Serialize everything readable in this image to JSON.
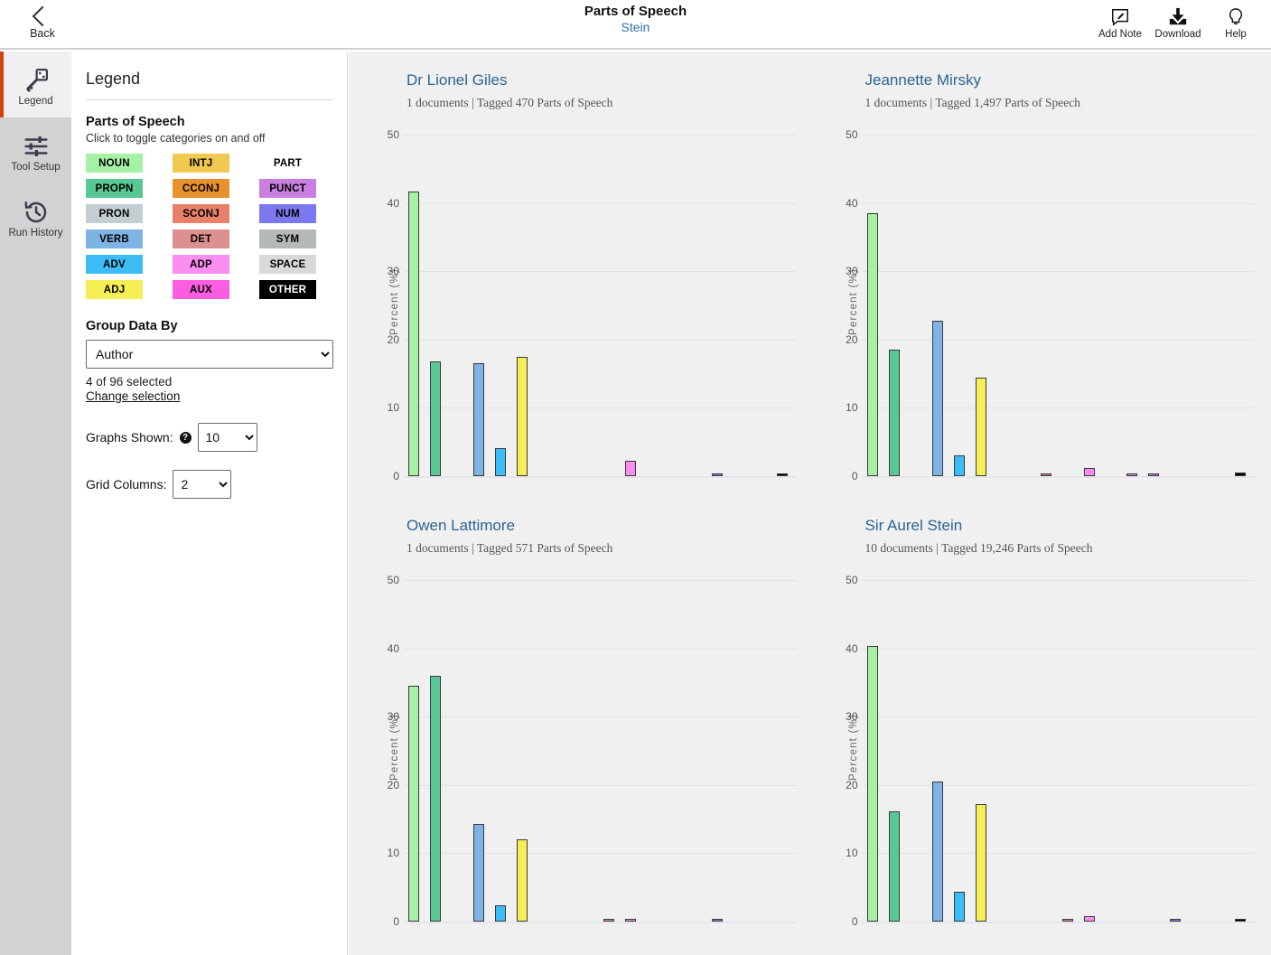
{
  "header": {
    "back_label": "Back",
    "back_icon": "chevron-left-icon",
    "title": "Parts of Speech",
    "subtitle": "Stein",
    "actions": [
      {
        "label": "Add Note",
        "icon": "add-note-icon"
      },
      {
        "label": "Download",
        "icon": "download-icon"
      },
      {
        "label": "Help",
        "icon": "lightbulb-help-icon"
      }
    ]
  },
  "rail": {
    "items": [
      {
        "label": "Legend",
        "icon": "key-icon",
        "active": true
      },
      {
        "label": "Tool Setup",
        "icon": "sliders-icon",
        "active": false
      },
      {
        "label": "Run History",
        "icon": "clock-history-icon",
        "active": false
      }
    ]
  },
  "legend": {
    "panel_title": "Legend",
    "pos_heading": "Parts of Speech",
    "pos_subtitle": "Click to toggle categories on and off",
    "categories": [
      {
        "label": "NOUN",
        "color": "#a5f2a5",
        "text_color": "#000000"
      },
      {
        "label": "INTJ",
        "color": "#f0c950",
        "text_color": "#000000"
      },
      {
        "label": "PART",
        "color": "#d munch",
        "text_color": "#000000"
      },
      {
        "label": "PROPN",
        "color": "#58c793",
        "text_color": "#000000"
      },
      {
        "label": "CCONJ",
        "color": "#e8922e",
        "text_color": "#000000"
      },
      {
        "label": "PUNCT",
        "color": "#c97fe0",
        "text_color": "#000000"
      },
      {
        "label": "PRON",
        "color": "#c3ced3",
        "text_color": "#000000"
      },
      {
        "label": "SCONJ",
        "color": "#e8806b",
        "text_color": "#000000"
      },
      {
        "label": "NUM",
        "color": "#7c78f0",
        "text_color": "#000000"
      },
      {
        "label": "VERB",
        "color": "#7fb2e5",
        "text_color": "#000000"
      },
      {
        "label": "DET",
        "color": "#dd9090",
        "text_color": "#000000"
      },
      {
        "label": "SYM",
        "color": "#b5b8b8",
        "text_color": "#000000"
      },
      {
        "label": "ADV",
        "color": "#3dbdf5",
        "text_color": "#000000"
      },
      {
        "label": "ADP",
        "color": "#fb8ef0",
        "text_color": "#000000"
      },
      {
        "label": "SPACE",
        "color": "#d9d9d9",
        "text_color": "#000000"
      },
      {
        "label": "ADJ",
        "color": "#f5ee55",
        "text_color": "#000000"
      },
      {
        "label": "AUX",
        "color": "#fb5de0",
        "text_color": "#000000"
      },
      {
        "label": "OTHER",
        "color": "#000000",
        "text_color": "#ffffff"
      }
    ],
    "group_heading": "Group Data By",
    "group_value": "Author",
    "group_options": [
      "Author"
    ],
    "selection_count": "4 of 96 selected",
    "change_selection": "Change selection",
    "graphs_shown_label": "Graphs Shown:",
    "graphs_shown_value": "10",
    "graphs_shown_options": [
      "10"
    ],
    "help_glyph": "?",
    "grid_columns_label": "Grid Columns:",
    "grid_columns_value": "2",
    "grid_columns_options": [
      "2"
    ]
  },
  "chart_data": [
    {
      "type": "bar",
      "title": "Dr Lionel Giles",
      "subtitle": "1 documents | Tagged 470 Parts of Speech",
      "documents": "1 documents",
      "tagged": "Tagged 470 Parts of Speech",
      "ylabel": "Percent (%)",
      "xlabel": "",
      "ylim": [
        0,
        50
      ],
      "yticks": [
        0,
        10,
        20,
        30,
        40,
        50
      ],
      "grid": true,
      "legend": "off",
      "categories": [
        "NOUN",
        "PROPN",
        "PRON",
        "VERB",
        "ADV",
        "ADJ",
        "INTJ",
        "CCONJ",
        "SCONJ",
        "DET",
        "ADP",
        "AUX",
        "PART",
        "PUNCT",
        "NUM",
        "SYM",
        "SPACE",
        "OTHER"
      ],
      "values": [
        41.7,
        16.8,
        0,
        16.5,
        4.1,
        17.4,
        0,
        0,
        0,
        0,
        2.3,
        0,
        0,
        0,
        0.3,
        0,
        0,
        0.3
      ],
      "colors": [
        "#a5f2a5",
        "#58c793",
        "#c3ced3",
        "#7fb2e5",
        "#3dbdf5",
        "#f5ee55",
        "#f0c950",
        "#e8922e",
        "#e8806b",
        "#dd9090",
        "#fb8ef0",
        "#fb5de0",
        "#d98ff0",
        "#c97fe0",
        "#7c78f0",
        "#b5b8b8",
        "#d9d9d9",
        "#000000"
      ]
    },
    {
      "type": "bar",
      "title": "Jeannette Mirsky",
      "subtitle": "1 documents | Tagged 1,497 Parts of Speech",
      "documents": "1 documents",
      "tagged": "Tagged 1,497 Parts of Speech",
      "ylabel": "Percent (%)",
      "xlabel": "",
      "ylim": [
        0,
        50
      ],
      "yticks": [
        0,
        10,
        20,
        30,
        40,
        50
      ],
      "grid": true,
      "legend": "off",
      "categories": [
        "NOUN",
        "PROPN",
        "PRON",
        "VERB",
        "ADV",
        "ADJ",
        "INTJ",
        "CCONJ",
        "SCONJ",
        "DET",
        "ADP",
        "AUX",
        "PART",
        "PUNCT",
        "NUM",
        "SYM",
        "SPACE",
        "OTHER"
      ],
      "values": [
        38.5,
        18.5,
        0,
        22.7,
        3.1,
        14.4,
        0,
        0,
        0.25,
        0,
        1.2,
        0,
        0.2,
        0.2,
        0,
        0,
        0,
        0.5
      ],
      "colors": [
        "#a5f2a5",
        "#58c793",
        "#c3ced3",
        "#7fb2e5",
        "#3dbdf5",
        "#f5ee55",
        "#f0c950",
        "#e8922e",
        "#e8806b",
        "#dd9090",
        "#fb8ef0",
        "#fb5de0",
        "#d98ff0",
        "#c97fe0",
        "#7c78f0",
        "#b5b8b8",
        "#d9d9d9",
        "#000000"
      ]
    },
    {
      "type": "bar",
      "title": "Owen Lattimore",
      "subtitle": "1 documents | Tagged 571 Parts of Speech",
      "documents": "1 documents",
      "tagged": "Tagged 571 Parts of Speech",
      "ylabel": "Percent (%)",
      "xlabel": "",
      "ylim": [
        0,
        50
      ],
      "yticks": [
        0,
        10,
        20,
        30,
        40,
        50
      ],
      "grid": true,
      "legend": "off",
      "categories": [
        "NOUN",
        "PROPN",
        "PRON",
        "VERB",
        "ADV",
        "ADJ",
        "INTJ",
        "CCONJ",
        "SCONJ",
        "DET",
        "ADP",
        "AUX",
        "PART",
        "PUNCT",
        "NUM",
        "SYM",
        "SPACE",
        "OTHER"
      ],
      "values": [
        34.5,
        36.0,
        0,
        14.3,
        2.4,
        12.0,
        0,
        0,
        0,
        0.3,
        0.4,
        0,
        0,
        0,
        0.3,
        0,
        0,
        0
      ],
      "colors": [
        "#a5f2a5",
        "#58c793",
        "#c3ced3",
        "#7fb2e5",
        "#3dbdf5",
        "#f5ee55",
        "#f0c950",
        "#e8922e",
        "#e8806b",
        "#dd9090",
        "#fb8ef0",
        "#fb5de0",
        "#d98ff0",
        "#c97fe0",
        "#7c78f0",
        "#b5b8b8",
        "#d9d9d9",
        "#000000"
      ]
    },
    {
      "type": "bar",
      "title": "Sir Aurel Stein",
      "subtitle": "10 documents | Tagged 19,246 Parts of Speech",
      "documents": "10 documents",
      "tagged": "Tagged 19,246 Parts of Speech",
      "ylabel": "Percent (%)",
      "xlabel": "",
      "ylim": [
        0,
        50
      ],
      "yticks": [
        0,
        10,
        20,
        30,
        40,
        50
      ],
      "grid": true,
      "legend": "off",
      "categories": [
        "NOUN",
        "PROPN",
        "PRON",
        "VERB",
        "ADV",
        "ADJ",
        "INTJ",
        "CCONJ",
        "SCONJ",
        "DET",
        "ADP",
        "AUX",
        "PART",
        "PUNCT",
        "NUM",
        "SYM",
        "SPACE",
        "OTHER"
      ],
      "values": [
        40.3,
        16.2,
        0,
        20.5,
        4.4,
        17.2,
        0,
        0,
        0,
        0.3,
        0.8,
        0,
        0,
        0,
        0.4,
        0,
        0,
        0.2
      ],
      "colors": [
        "#a5f2a5",
        "#58c793",
        "#c3ced3",
        "#7fb2e5",
        "#3dbdf5",
        "#f5ee55",
        "#f0c950",
        "#e8922e",
        "#e8806b",
        "#dd9090",
        "#fb8ef0",
        "#fb5de0",
        "#d98ff0",
        "#c97fe0",
        "#7c78f0",
        "#b5b8b8",
        "#d9d9d9",
        "#000000"
      ]
    }
  ]
}
